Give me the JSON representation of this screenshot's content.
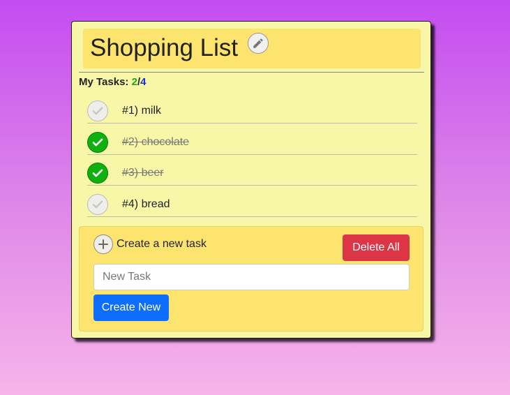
{
  "list": {
    "title": "Shopping List",
    "edit_icon": "pencil-icon"
  },
  "counter": {
    "label": "My Tasks:",
    "done": "2",
    "separator": "/",
    "total": "4"
  },
  "tasks": [
    {
      "label": "#1) milk",
      "done": false
    },
    {
      "label": "#2) chocolate",
      "done": true
    },
    {
      "label": "#3) beer",
      "done": true
    },
    {
      "label": "#4) bread",
      "done": false
    }
  ],
  "panel": {
    "add_icon": "plus-icon",
    "create_label": "Create a new task",
    "delete_all_label": "Delete All",
    "input_placeholder": "New Task",
    "input_value": "",
    "create_button_label": "Create New"
  },
  "colors": {
    "done_check": "#10b10f",
    "done_count": "#1fa319",
    "total_count": "#1530d8",
    "delete_button": "#dc3545",
    "create_button": "#0d6efd",
    "card_background": "#f8f7a8",
    "panel_background": "#fde46f"
  }
}
